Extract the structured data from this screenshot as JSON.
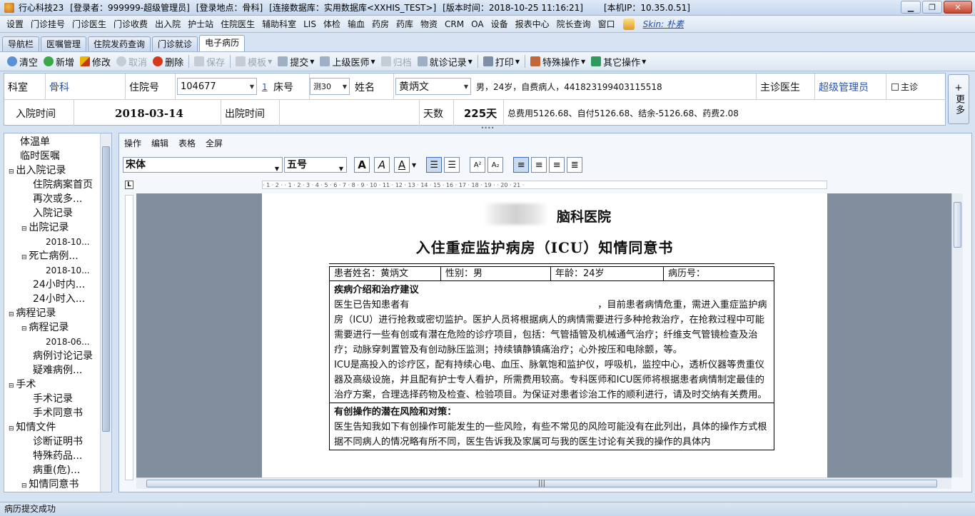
{
  "titlebar": {
    "app": "行心科技23",
    "login": "[登录者：999999-超级管理员]",
    "place": "[登录地点：骨科]",
    "db": "[连接数据库：实用数据库<XXHIS_TEST>]",
    "version": "[版本时间：2018-10-25 11:16:21]",
    "ip": "[本机IP：10.35.0.51]"
  },
  "menu": [
    "设置",
    "门诊挂号",
    "门诊医生",
    "门诊收费",
    "出入院",
    "护士站",
    "住院医生",
    "辅助科室",
    "LIS",
    "体检",
    "输血",
    "药房",
    "药库",
    "物资",
    "CRM",
    "OA",
    "设备",
    "报表中心",
    "院长查询",
    "窗口"
  ],
  "skin": "Skin: 朴素",
  "tabs": [
    "导航栏",
    "医嘱管理",
    "住院发药查询",
    "门诊就诊",
    "电子病历"
  ],
  "toolbar": {
    "clear": "清空",
    "add": "新增",
    "edit": "修改",
    "cancel": "取消",
    "delete": "删除",
    "save": "保存",
    "template": "模板",
    "submit": "提交",
    "superior": "上级医师",
    "archive": "归档",
    "visits": "就诊记录",
    "print": "打印",
    "special": "特殊操作",
    "other": "其它操作"
  },
  "patient": {
    "dept_label": "科室",
    "dept": "骨科",
    "inpatient_label": "住院号",
    "inpatient_no": "104677",
    "link_num": "1",
    "bed_label": "床号",
    "bed": "测30",
    "name_label": "姓名",
    "name": "黄炳文",
    "detail": "男，24岁，自费病人，441823199403115518",
    "doctor_label": "主诊医生",
    "doctor": "超级管理员",
    "main_label": "主诊",
    "admit_label": "入院时间",
    "admit": "2018-03-14",
    "discharge_label": "出院时间",
    "discharge": "",
    "days_label": "天数",
    "days": "225天",
    "fees": "总费用5126.68、自付5126.68、结余-5126.68、药费2.08"
  },
  "more_button": "更多",
  "tree": [
    "体温单",
    "临时医嘱",
    "出入院记录",
    "住院病案首页",
    "再次或多...",
    "入院记录",
    "出院记录",
    "2018-10...",
    "死亡病例...",
    "2018-10...",
    "24小时内...",
    "24小时入...",
    "病程记录",
    "病程记录",
    "2018-06...",
    "病例讨论记录",
    "疑难病例...",
    "手术",
    "手术记录",
    "手术同意书",
    "知情文件",
    "诊断证明书",
    "特殊药品...",
    "病重(危)...",
    "知情同意书"
  ],
  "editor_menu": [
    "操作",
    "编辑",
    "表格",
    "全屏"
  ],
  "font": {
    "family": "宋体",
    "size": "五号"
  },
  "ruler_text": "· 1 · 2 ·  · 1 · 2 · 3 · 4 · 5 · 6 · 7 · 8 · 9 · 10 · 11 · 12 · 13 · 14 · 15 · 16 · 17 · 18 · 19 ·  · 20 · 21 ·",
  "document": {
    "hospital": "脑科医院",
    "title": "入住重症监护病房（ICU）知情同意书",
    "patient_name": "患者姓名：黄炳文",
    "sex": "性别：男",
    "age": "年龄：24岁",
    "record_no": "病历号：",
    "sec1_head": "疾病介绍和治疗建议",
    "sec1_p1": "医生已告知患者有　　　　　　　　　　　　　　　　　　　　，目前患者病情危重，需进入重症监护病房（ICU）进行抢救或密切监护。医护人员将根据病人的病情需要进行多种抢救治疗，在抢救过程中可能需要进行一些有创或有潜在危险的诊疗项目，包括：气管插管及机械通气治疗；纤维支气管镜检查及治疗；动脉穿刺置管及有创动脉压监测；持续镇静镇痛治疗；心外按压和电除颤，等。",
    "sec1_p2": "ICU是高投入的诊疗区，配有持续心电、血压、脉氧饱和监护仪，呼吸机，监控中心，透析仪器等贵重仪器及高级设施，并且配有护士专人看护，所需费用较高。专科医师和ICU医师将根据患者病情制定最佳的治疗方案，合理选择药物及检查、检验项目。为保证对患者诊治工作的顺利进行，请及时交纳有关费用。",
    "sec2_head": "有创操作的潜在风险和对策：",
    "sec2_p1": "医生告知我如下有创操作可能发生的一些风险，有些不常见的风险可能没有在此列出，具体的操作方式根据不同病人的情况略有所不同，医生告诉我及家属可与我的医生讨论有关我的操作的具体内"
  },
  "status": "病历提交成功"
}
